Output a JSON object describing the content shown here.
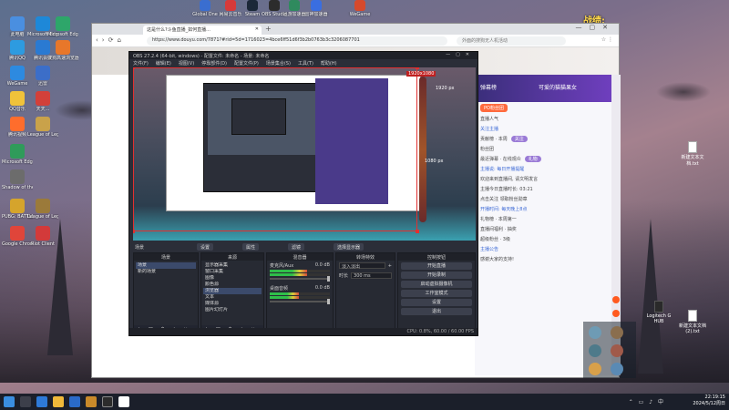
{
  "desktop": {
    "icons_left": [
      {
        "label": "此电脑",
        "color": "#4a8fe0"
      },
      {
        "label": "Microsoft Edge",
        "color": "#1e88d8"
      },
      {
        "label": "Microsoft Edge",
        "color": "#2ea66a"
      },
      {
        "label": "腾讯QQ",
        "color": "#2d9be0"
      },
      {
        "label": "腾讯会议",
        "color": "#2a7ad2"
      },
      {
        "label": "搜狗高速浏览器",
        "color": "#e8772a"
      },
      {
        "label": "WeGame",
        "color": "#2d8ae0"
      },
      {
        "label": "迅雷",
        "color": "#3c6ec8"
      },
      {
        "label": "QQ音乐",
        "color": "#f0c23a"
      },
      {
        "label": "天天...",
        "color": "#d2403a"
      },
      {
        "label": "腾讯视频",
        "color": "#ff6d2c"
      },
      {
        "label": "League of Legends",
        "color": "#c9a24a"
      },
      {
        "label": "Microsoft Edge",
        "color": "#2f9b5a"
      },
      {
        "label": "Shadow of the Tomb",
        "color": "#6c6c6c"
      },
      {
        "label": "PUBG: BATTLEGROUNDS",
        "color": "#d5a42c"
      },
      {
        "label": "League of Legends",
        "color": "#9b7a3a"
      },
      {
        "label": "Google Chrome",
        "color": "#e0453a"
      },
      {
        "label": "Riot Client",
        "color": "#d33a3a"
      }
    ],
    "icons_top": [
      {
        "label": "Global One",
        "color": "#3a6ed0"
      },
      {
        "label": "网易云音乐",
        "color": "#d63a3a"
      },
      {
        "label": "Steam",
        "color": "#1b2838"
      },
      {
        "label": "OBS Studio",
        "color": "#2c2c2c"
      },
      {
        "label": "迅游加速器",
        "color": "#2f8a5e"
      },
      {
        "label": "雷神加速器",
        "color": "#3a6ee0"
      },
      {
        "label": "WeGame",
        "color": "#d64a2c"
      }
    ],
    "right_files": [
      {
        "label": "新建文本文档.txt"
      },
      {
        "label": "Logitech G HUB"
      },
      {
        "label": "新建文本文档(2).txt"
      }
    ],
    "overlay_text": "战绩:"
  },
  "browser": {
    "tab_title": "这是什么?斗鱼直播_如何直播...",
    "url": "https://www.douyu.com/7871?#rid=5d=1716023=4bce6ff51d6f3b2b0763b3c3206087701",
    "search_placeholder": "外面的搜狗无人机活动",
    "page_right_title_1": "弹幕榜",
    "page_right_title_2": "可爱的猫猫果女",
    "side_lines": [
      "直播人气",
      "关注主播",
      "贡献榜 · 本周",
      "粉丝团",
      "最近弹幕 · 在线观众",
      "主播说: 每日开播提醒",
      "欢迎来到直播间, 请文明发言",
      "主播今日直播时长: 03:21",
      "点击关注 领取粉丝勋章",
      "开播时间: 每天晚上8点",
      "礼物榜 · 本周第一",
      "直播间福利 · 抽奖",
      "超级粉丝 · 3级",
      "主播公告",
      "感谢大家的支持!"
    ],
    "side_badges": [
      "PO粉丝团",
      "关注",
      "礼物"
    ]
  },
  "obs": {
    "title": "OBS 27.2.4 (64-bit, windows) - 配置文件: 未命名 - 场景: 未命名",
    "menu": [
      "文件(F)",
      "编辑(E)",
      "视图(V)",
      "停靠部件(D)",
      "配置文件(P)",
      "场景集合(S)",
      "工具(T)",
      "帮助(H)"
    ],
    "preview_label_top": "1920 px",
    "preview_label_right": "1080 px",
    "preview_label_size": "1920x1080",
    "scene_name": "场景",
    "scene_buttons": [
      "设置",
      "属性",
      "滤镜",
      "选择显示器"
    ],
    "docks": {
      "scenes": {
        "title": "场景",
        "items": [
          "场景",
          "新的场景"
        ]
      },
      "sources": {
        "title": "来源",
        "items": [
          "显示器采集",
          "窗口采集",
          "图像",
          "颜色源",
          "浏览器",
          "文本",
          "媒体源",
          "图片幻灯片"
        ]
      },
      "mixer": {
        "title": "混音器",
        "channels": [
          {
            "name": "麦克风/Aux",
            "db": "0.0 dB",
            "level": 0.62
          },
          {
            "name": "桌面音频",
            "db": "0.0 dB",
            "level": 0.48
          }
        ]
      },
      "transitions": {
        "title": "转场特效",
        "type": "淡入淡出",
        "duration_label": "时长",
        "duration": "300 ms"
      },
      "controls": {
        "title": "控制按钮",
        "buttons": [
          "开始直播",
          "开始录制",
          "启动虚拟摄像机",
          "工作室模式",
          "设置",
          "退出"
        ]
      }
    },
    "status": "CPU: 0.8%, 60.00 / 60.00 FPS"
  },
  "taskbar": {
    "time": "22:19:15",
    "date": "2024/5/12周日"
  },
  "colors": {
    "obs_bg": "#2b2e38",
    "accent_red": "#e23030",
    "douyu_purple": "#4a3a8a",
    "douyu_orange": "#ff6a3d"
  }
}
